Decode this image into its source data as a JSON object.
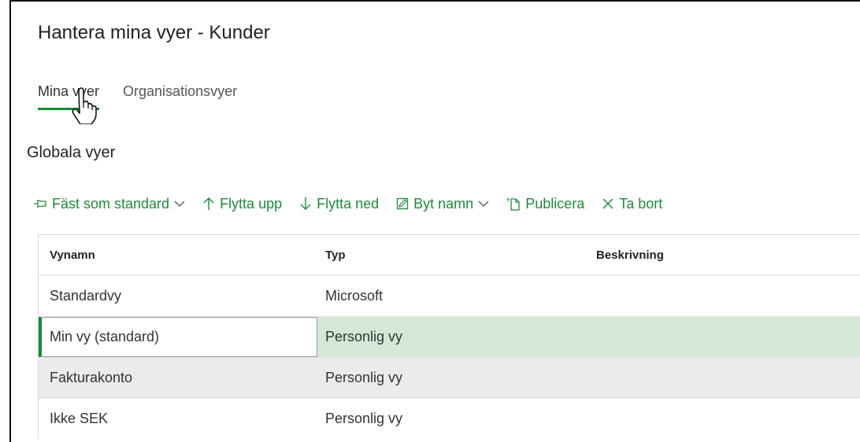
{
  "dialog": {
    "title": "Hantera mina vyer - Kunder"
  },
  "tabs": [
    {
      "label": "Mina vyer",
      "active": true
    },
    {
      "label": "Organisationsvyer",
      "active": false
    }
  ],
  "section": {
    "title": "Globala vyer"
  },
  "toolbar": {
    "pin_label": "Fäst som standard",
    "move_up_label": "Flytta upp",
    "move_down_label": "Flytta ned",
    "rename_label": "Byt namn",
    "publish_label": "Publicera",
    "delete_label": "Ta bort"
  },
  "grid": {
    "columns": [
      "Vynamn",
      "Typ",
      "Beskrivning"
    ],
    "rows": [
      {
        "name": "Standardvy",
        "type": "Microsoft",
        "description": ""
      },
      {
        "name": "Min vy (standard)",
        "type": "Personlig vy",
        "description": ""
      },
      {
        "name": "Fakturakonto",
        "type": "Personlig vy",
        "description": ""
      },
      {
        "name": "Ikke SEK",
        "type": "Personlig vy",
        "description": ""
      }
    ]
  },
  "colors": {
    "accent": "#138a36",
    "selected_row": "#d3e9d6",
    "hover_row": "#ebebeb"
  },
  "icons": [
    "pin-icon",
    "chevron-down-icon",
    "arrow-up-icon",
    "arrow-down-icon",
    "rename-icon",
    "publish-icon",
    "close-icon",
    "hand-cursor-icon"
  ]
}
